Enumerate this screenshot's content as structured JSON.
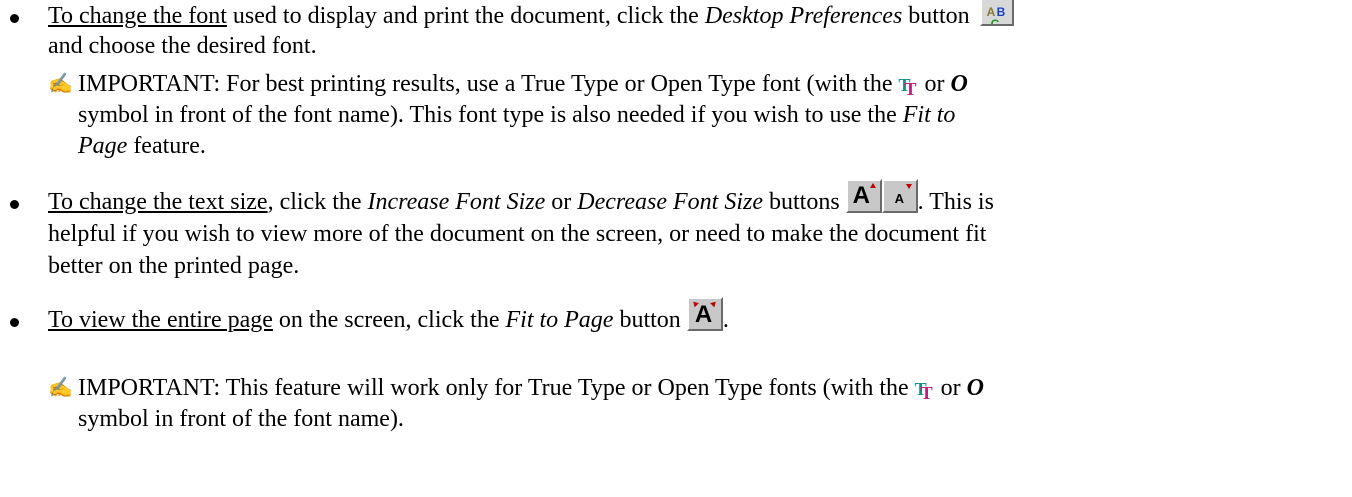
{
  "items": [
    {
      "link": "To change the font",
      "line1_a": " used to display and print the document, click the ",
      "line1_em": "Desktop Preferences",
      "line1_b": " button",
      "line2": "and choose the desired font.",
      "button_icon": "desktop-preferences-icon",
      "note": {
        "icon": "writing-hand-icon",
        "line1_a": "IMPORTANT: For best printing results, use a True Type or Open Type font (with the ",
        "line1_b": " or ",
        "line2_a": "symbol in front of the font name).  This font type is also needed if you wish to use the ",
        "line2_em": "Fit to",
        "line3_em": "Page",
        "line3_b": " feature."
      }
    },
    {
      "link": "To change the text size",
      "line1_a": ", click the ",
      "line1_em1": "Increase Font Size",
      "line1_or": " or ",
      "line1_em2": "Decrease Font Size",
      "line1_b": " buttons ",
      "line1_c": ".  This is",
      "line2": "helpful if you wish to view more of the document on the screen, or need to make the document fit",
      "line3": "better on the printed page.",
      "button_icons": [
        "increase-font-size-icon",
        "decrease-font-size-icon"
      ]
    },
    {
      "link": "To view the entire page",
      "line1_a": " on the screen, click the ",
      "line1_em": "Fit to Page",
      "line1_b": " button ",
      "line1_c": ".",
      "button_icon": "fit-to-page-icon",
      "note": {
        "icon": "writing-hand-icon",
        "line1_a": "IMPORTANT:  This feature will work only for True Type or Open Type fonts (with the ",
        "line1_b": " or ",
        "line2": "symbol in front of the font name)."
      }
    }
  ],
  "icons": {
    "truetype": "truetype-font-icon",
    "opentype": "opentype-font-icon"
  },
  "colors": {
    "truetype_teal": "#1b8c8c",
    "truetype_magenta": "#c01f7a",
    "arrow_red": "#c00000"
  }
}
